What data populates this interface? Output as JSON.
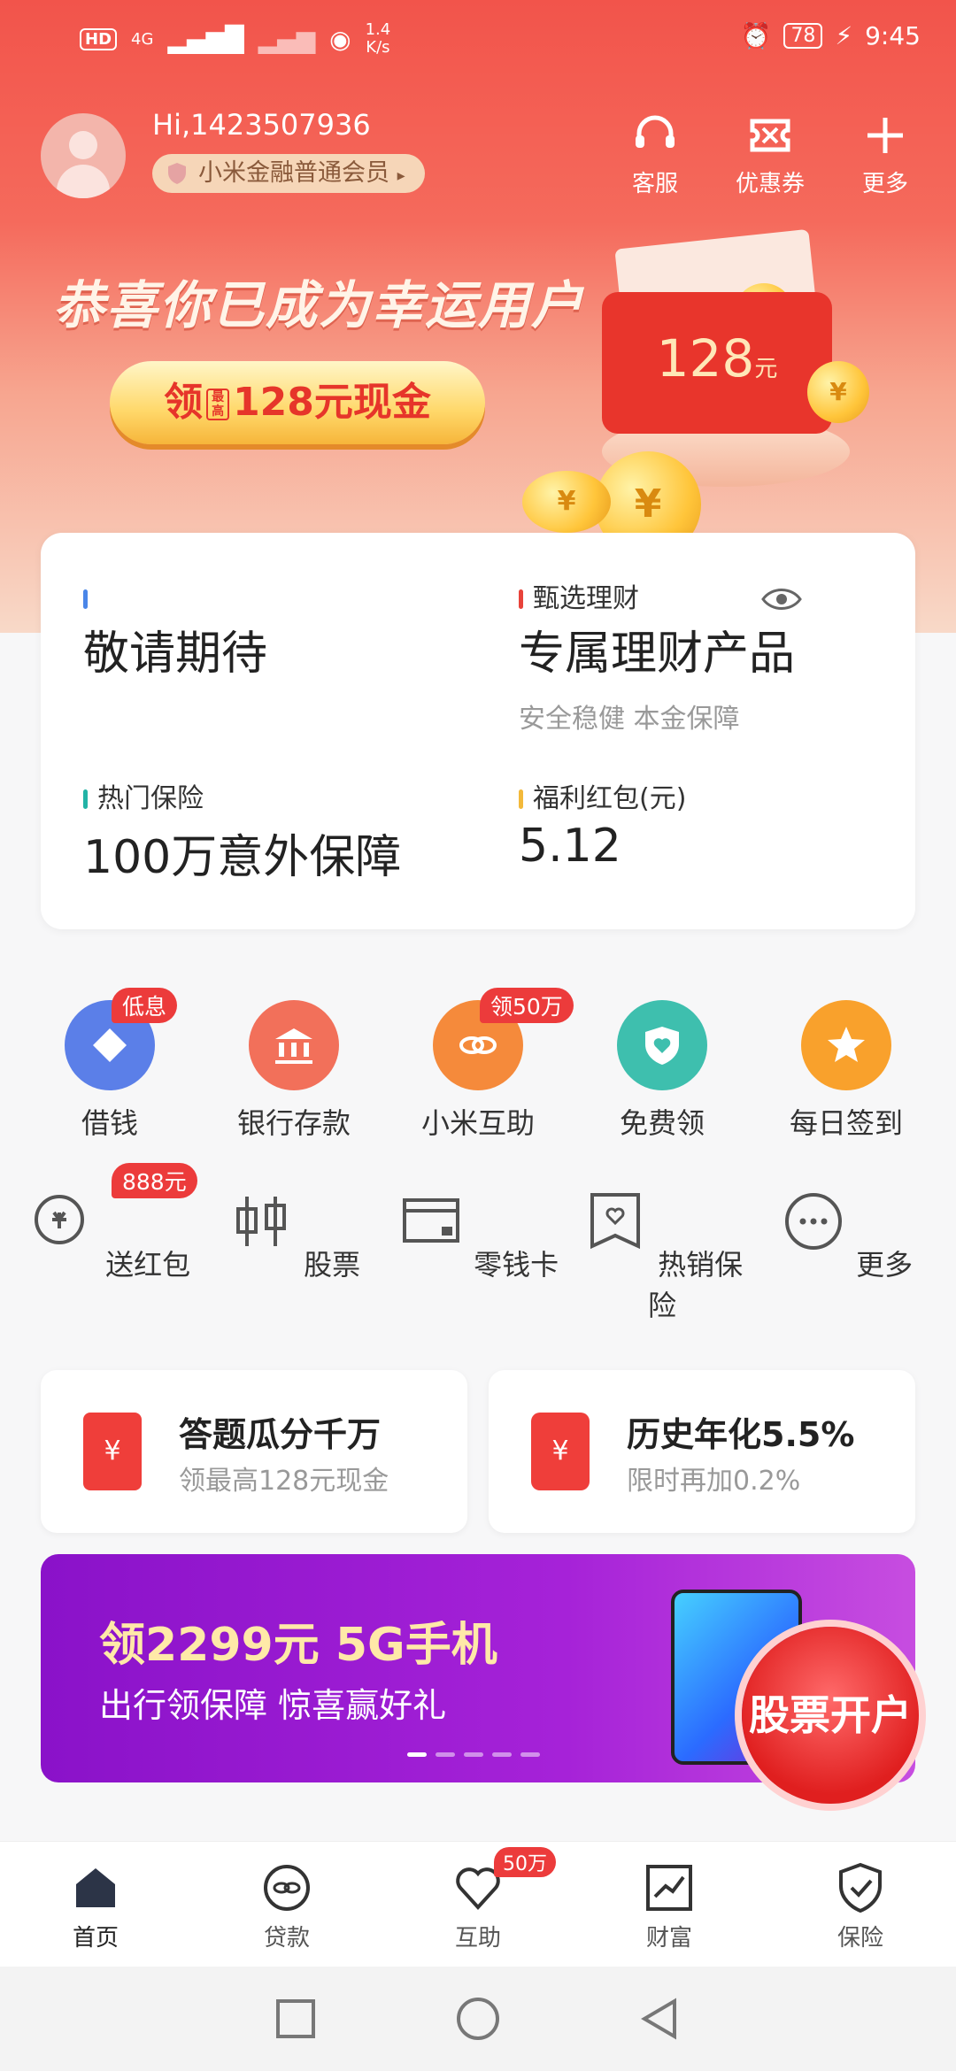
{
  "status": {
    "net_speed_value": "1.4",
    "net_speed_unit": "K/s",
    "battery": "78",
    "time": "9:45",
    "hd": "HD",
    "net_type": "4G",
    "sim": "1"
  },
  "user": {
    "greeting": "Hi,1423507936",
    "member": "小米金融普通会员"
  },
  "top_actions": [
    {
      "label": "客服",
      "icon": "headset-icon"
    },
    {
      "label": "优惠券",
      "icon": "ticket-icon"
    },
    {
      "label": "更多",
      "icon": "plus-icon"
    }
  ],
  "hero": {
    "slogan": "恭喜你已成为幸运用户",
    "cta_prefix": "领",
    "cta_tag": "最高",
    "cta_amount": "128元现金",
    "envelope_amount": "128",
    "envelope_unit": "元",
    "coin_symbol": "¥"
  },
  "summary": {
    "cell1": {
      "big": "敬请期待"
    },
    "cell2": {
      "label": "甄选理财",
      "big": "专属理财产品",
      "sub": "安全稳健  本金保障"
    },
    "cell3": {
      "label": "热门保险",
      "big": "100万意外保障"
    },
    "cell4": {
      "label": "福利红包(元)",
      "big": "5.12"
    }
  },
  "grid_row1": [
    {
      "label": "借钱",
      "badge": "低息",
      "color": "#5b7fe8"
    },
    {
      "label": "银行存款",
      "badge": "",
      "color": "#f2705a"
    },
    {
      "label": "小米互助",
      "badge": "领50万",
      "color": "#f58a3b"
    },
    {
      "label": "免费领",
      "badge": "",
      "color": "#3ebfae"
    },
    {
      "label": "每日签到",
      "badge": "",
      "color": "#f9a12c"
    }
  ],
  "grid_row2": [
    {
      "label": "送红包",
      "badge": "888元"
    },
    {
      "label": "股票",
      "badge": ""
    },
    {
      "label": "零钱卡",
      "badge": ""
    },
    {
      "label": "热销保险",
      "badge": ""
    },
    {
      "label": "更多",
      "badge": ""
    }
  ],
  "promos": [
    {
      "title": "答题瓜分千万",
      "desc": "领最高128元现金",
      "icon": "¥"
    },
    {
      "title": "历史年化5.5%",
      "desc": "限时再加0.2%",
      "icon": "¥"
    }
  ],
  "banner": {
    "title": "领2299元 5G手机",
    "subtitle": "出行领保障 惊喜赢好礼",
    "float_label": "股票开户"
  },
  "tabs": [
    {
      "label": "首页",
      "badge": ""
    },
    {
      "label": "贷款",
      "badge": ""
    },
    {
      "label": "互助",
      "badge": "50万"
    },
    {
      "label": "财富",
      "badge": ""
    },
    {
      "label": "保险",
      "badge": ""
    }
  ],
  "colors": {
    "primary": "#f2544b",
    "accent": "#ec3b3b",
    "banner": "#9b1ad3"
  }
}
